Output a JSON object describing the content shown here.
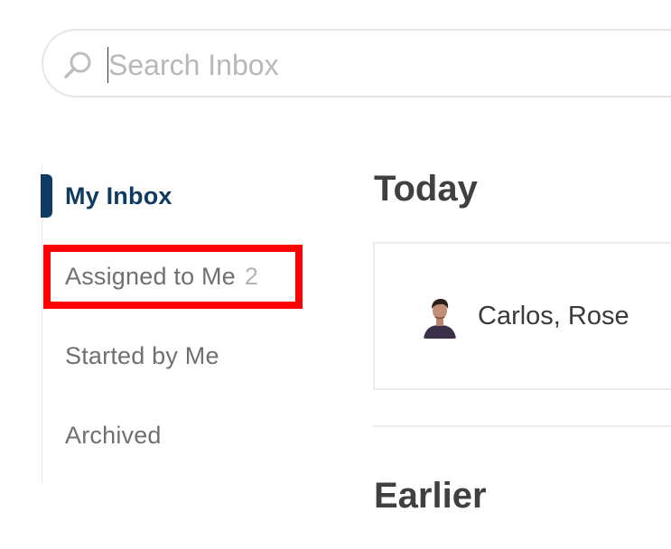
{
  "search": {
    "placeholder": "Search Inbox",
    "icon": "search-icon"
  },
  "sidebar": {
    "items": [
      {
        "label": "My Inbox",
        "active": true
      },
      {
        "label": "Assigned to Me",
        "count": "2",
        "highlighted": true
      },
      {
        "label": "Started by Me"
      },
      {
        "label": "Archived"
      }
    ],
    "active_indicator_color": "#0f3b63"
  },
  "main": {
    "sections": [
      {
        "title": "Today",
        "conversations": [
          {
            "participants": "Carlos, Rose",
            "avatar": "avatar"
          }
        ]
      },
      {
        "title": "Earlier"
      }
    ]
  },
  "colors": {
    "accent": "#0f3b63",
    "highlight": "#ff0000",
    "muted_text": "#707070",
    "count_text": "#b3b3b3"
  }
}
